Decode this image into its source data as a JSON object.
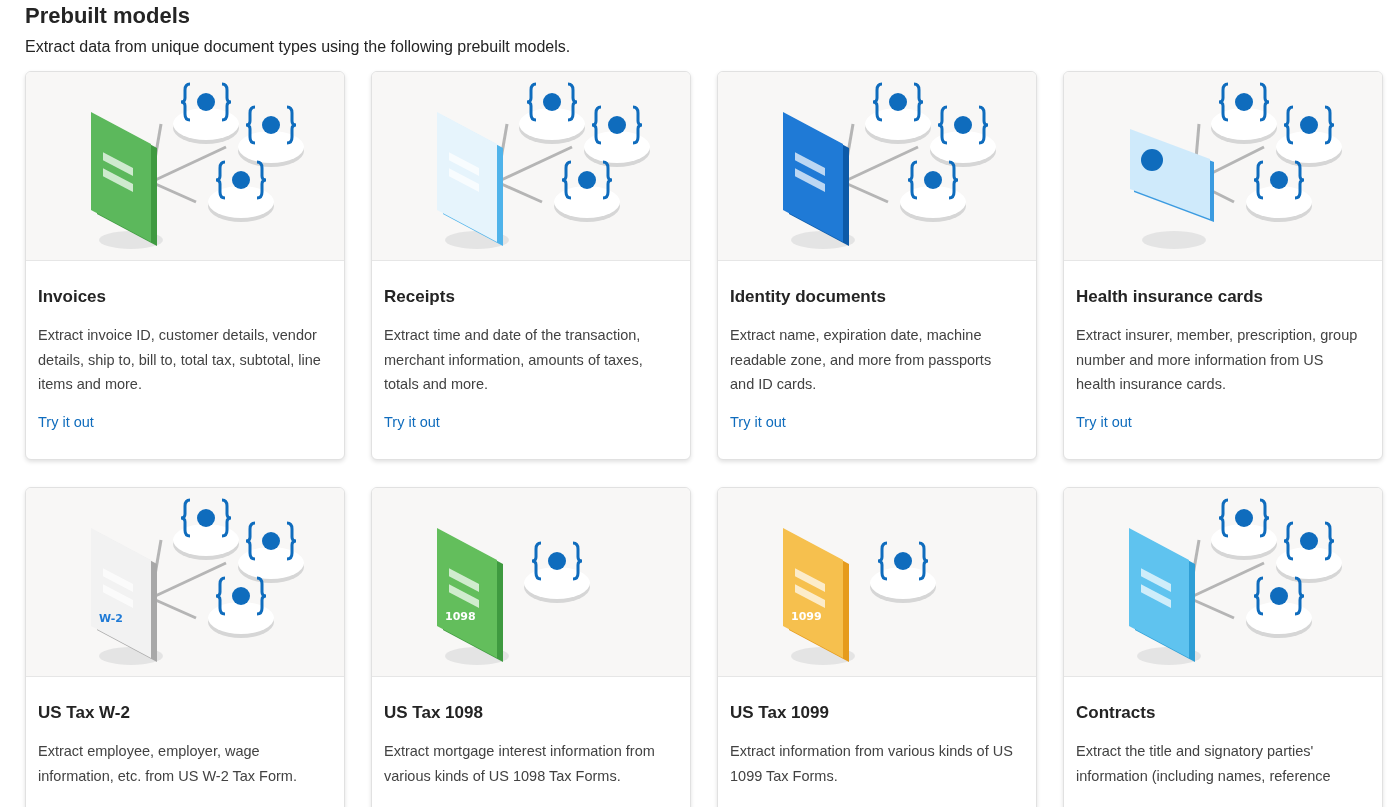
{
  "title": "Prebuilt models",
  "subtitle": "Extract data from unique document types using the following prebuilt models.",
  "cards": [
    {
      "kind": "invoice",
      "title": "Invoices",
      "description": "Extract invoice ID, customer details, vendor details, ship to, bill to, total tax, subtotal, line items and more.",
      "link": "Try it out"
    },
    {
      "kind": "receipt",
      "title": "Receipts",
      "description": "Extract time and date of the transaction, merchant information, amounts of taxes, totals and more.",
      "link": "Try it out"
    },
    {
      "kind": "identity",
      "title": "Identity documents",
      "description": "Extract name, expiration date, machine readable zone, and more from passports and ID cards.",
      "link": "Try it out"
    },
    {
      "kind": "health",
      "title": "Health insurance cards",
      "description": "Extract insurer, member, prescription, group number and more information from US health insurance cards.",
      "link": "Try it out"
    },
    {
      "kind": "w2",
      "form_label": "W-2",
      "title": "US Tax W-2",
      "description": "Extract employee, employer, wage information, etc. from US W-2 Tax Form."
    },
    {
      "kind": "mortgage",
      "form_label": "1098",
      "title": "US Tax 1098",
      "description": "Extract mortgage interest information from various kinds of US 1098 Tax Forms."
    },
    {
      "kind": "income",
      "form_label": "1099",
      "title": "US Tax 1099",
      "description": "Extract information from various kinds of US 1099 Tax Forms."
    },
    {
      "kind": "contract",
      "title": "Contracts",
      "description": "Extract the title and signatory parties' information (including names, reference"
    }
  ]
}
